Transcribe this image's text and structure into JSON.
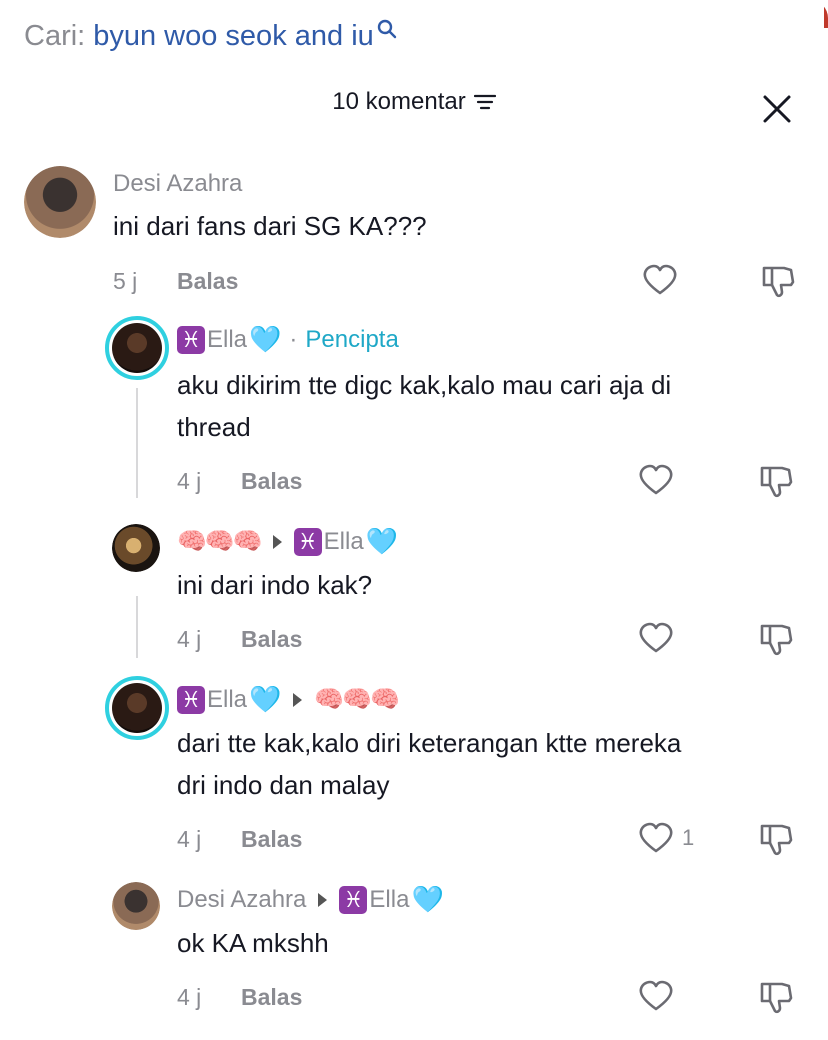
{
  "search": {
    "label": "Cari:",
    "query": "byun woo seok and iu"
  },
  "header": {
    "comment_count": "10 komentar"
  },
  "comments": [
    {
      "user": "Desi Azahra",
      "text": [
        "ini dari fans dari SG KA???"
      ],
      "time": "5 j",
      "reply": "Balas"
    },
    {
      "user": "Ella",
      "badge": "Pencipta",
      "text": [
        "aku dikirim tte digc kak,kalo mau cari aja di",
        "thread"
      ],
      "time": "4 j",
      "reply": "Balas"
    },
    {
      "user": "🧠🧠🧠",
      "reply_to": "Ella",
      "text": [
        "ini dari indo kak?"
      ],
      "time": "4 j",
      "reply": "Balas"
    },
    {
      "user": "Ella",
      "reply_to": "🧠🧠🧠",
      "text": [
        "dari tte kak,kalo diri keterangan ktte mereka",
        "dri indo dan malay"
      ],
      "time": "4 j",
      "reply": "Balas",
      "likes": "1"
    },
    {
      "user": "Desi Azahra",
      "reply_to": "Ella",
      "text": [
        "ok KA mkshh"
      ],
      "time": "4 j",
      "reply": "Balas"
    }
  ],
  "symbols": {
    "pisces": "♓",
    "blue_heart": "🩵"
  },
  "colors": {
    "accent": "#2fd0e0",
    "creator": "#1fa8c7",
    "search_query": "#2f5aa8"
  },
  "icons": [
    "search-icon",
    "filter-icon",
    "close-icon",
    "heart-icon",
    "dislike-icon"
  ]
}
